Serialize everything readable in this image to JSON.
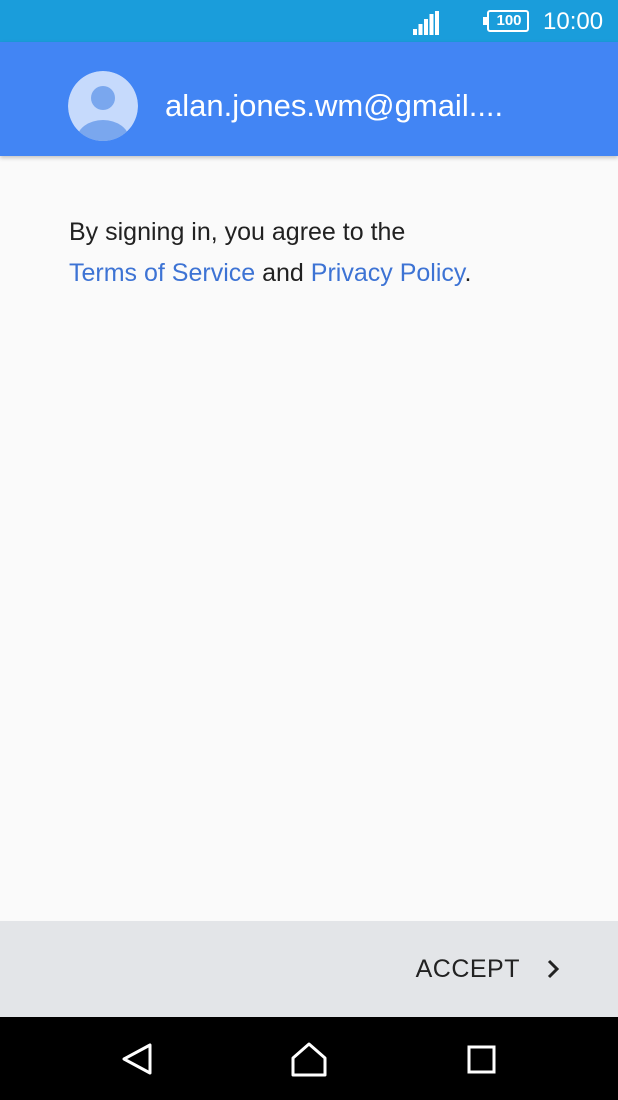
{
  "status_bar": {
    "battery_level": "100",
    "time": "10:00",
    "icons": [
      "signal-icon",
      "battery-icon"
    ]
  },
  "header": {
    "avatar_icon": "account-circle-icon",
    "account_email": "alan.jones.wm@gmail...."
  },
  "terms": {
    "intro": "By signing in, you agree to the",
    "terms_link": "Terms of Service",
    "conjunction": "and",
    "privacy_link": "Privacy Policy",
    "end_punctuation": "."
  },
  "footer": {
    "accept_label": "ACCEPT",
    "accept_icon": "chevron-right-icon"
  },
  "nav_bar": {
    "icons": [
      "back-icon",
      "home-icon",
      "recents-icon"
    ]
  },
  "colors": {
    "status_bar": "#1a9ddb",
    "header": "#4285f4",
    "link": "#3d73d4",
    "footer": "#e3e5e8",
    "background": "#fafafa"
  }
}
